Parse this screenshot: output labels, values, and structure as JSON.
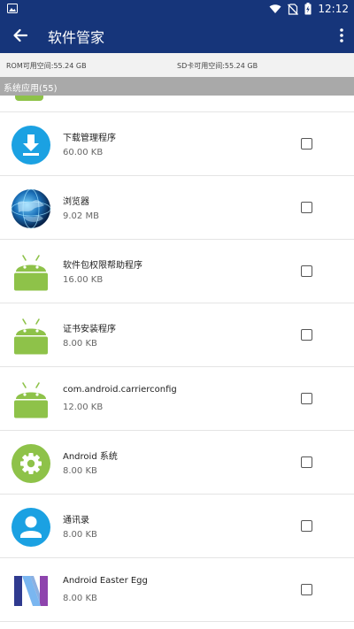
{
  "status_bar": {
    "time": "12:12",
    "left_icon": "image-notification-icon",
    "right_icons": [
      "wifi-icon",
      "no-sim-icon",
      "battery-charging-icon"
    ]
  },
  "app_bar": {
    "title": "软件管家",
    "back_icon": "back-arrow-icon",
    "menu_icon": "more-vert-icon"
  },
  "storage": {
    "rom": "ROM可用空间:55.24 GB",
    "sd": "SD卡可用空间:55.24 GB"
  },
  "section": {
    "title": "系统应用(55)"
  },
  "colors": {
    "primary": "#16357a",
    "android_green": "#8ec249",
    "download_blue": "#1ba1e2",
    "section_gray": "#a9a9a9"
  },
  "apps": [
    {
      "name": "下载管理程序",
      "size": "60.00 KB",
      "icon": "download-icon",
      "checked": false
    },
    {
      "name": "浏览器",
      "size": "9.02 MB",
      "icon": "browser-globe-icon",
      "checked": false
    },
    {
      "name": "软件包权限帮助程序",
      "size": "16.00 KB",
      "icon": "android-icon",
      "checked": false
    },
    {
      "name": "证书安装程序",
      "size": "8.00 KB",
      "icon": "android-icon",
      "checked": false
    },
    {
      "name": "com.android.carrierconfig",
      "size": "12.00 KB",
      "icon": "android-icon",
      "checked": false
    },
    {
      "name": "Android 系统",
      "size": "8.00 KB",
      "icon": "settings-gear-icon",
      "checked": false
    },
    {
      "name": "通讯录",
      "size": "8.00 KB",
      "icon": "contacts-icon",
      "checked": false
    },
    {
      "name": "Android Easter Egg",
      "size": "8.00 KB",
      "icon": "nougat-n-icon",
      "checked": false
    }
  ]
}
